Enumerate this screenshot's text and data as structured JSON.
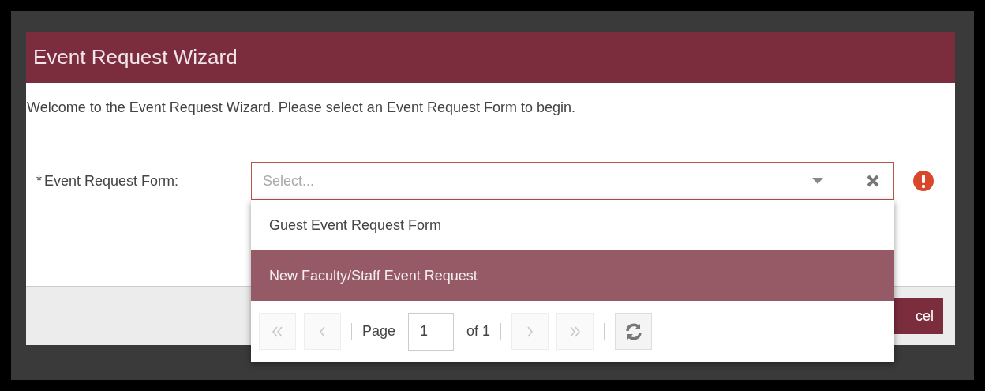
{
  "dialog": {
    "title": "Event Request Wizard",
    "intro": "Welcome to the Event Request Wizard. Please select an Event Request Form to begin.",
    "field": {
      "required_mark": "*",
      "label": "Event Request Form:",
      "placeholder": "Select...",
      "invalid": true
    },
    "dropdown": {
      "options": [
        {
          "label": "Guest Event Request Form",
          "selected": false
        },
        {
          "label": "New Faculty/Staff Event Request",
          "selected": true
        }
      ],
      "pager": {
        "first": {
          "disabled": true
        },
        "prev": {
          "disabled": true
        },
        "page_label": "Page",
        "page": "1",
        "of": "of 1",
        "next": {
          "disabled": true
        },
        "last": {
          "disabled": true
        }
      }
    },
    "footer_button": "cel"
  }
}
